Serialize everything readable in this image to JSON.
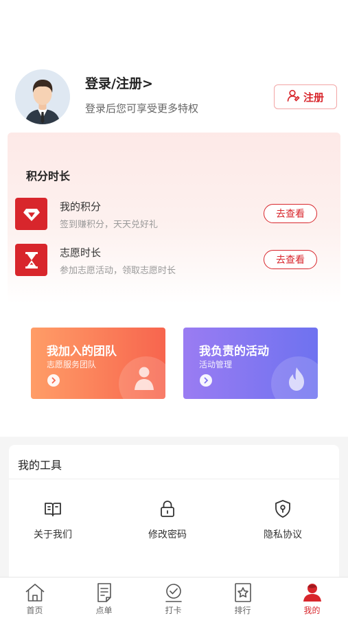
{
  "profile": {
    "login_title": "登录/注册>",
    "login_subtitle": "登录后您可享受更多特权",
    "register_label": "注册"
  },
  "points": {
    "section_title": "积分时长",
    "rows": [
      {
        "icon": "diamond-icon",
        "title": "我的积分",
        "subtitle": "签到赚积分，天天兑好礼",
        "action": "去查看"
      },
      {
        "icon": "hourglass-icon",
        "title": "志愿时长",
        "subtitle": "参加志愿活动，领取志愿时长",
        "action": "去查看"
      }
    ]
  },
  "cards": [
    {
      "title": "我加入的团队",
      "subtitle": "志愿服务团队",
      "icon": "person-icon"
    },
    {
      "title": "我负责的活动",
      "subtitle": "活动管理",
      "icon": "flame-icon"
    }
  ],
  "tools": {
    "title": "我的工具",
    "items": [
      {
        "label": "关于我们",
        "icon": "book-icon"
      },
      {
        "label": "修改密码",
        "icon": "lock-icon"
      },
      {
        "label": "隐私协议",
        "icon": "shield-lock-icon"
      }
    ]
  },
  "tabbar": {
    "tabs": [
      {
        "label": "首页",
        "icon": "home-icon"
      },
      {
        "label": "点单",
        "icon": "order-icon"
      },
      {
        "label": "打卡",
        "icon": "check-in-icon"
      },
      {
        "label": "排行",
        "icon": "ranking-icon"
      },
      {
        "label": "我的",
        "icon": "profile-icon"
      }
    ],
    "active_index": 4
  },
  "colors": {
    "primary": "#d8262c",
    "team_card": "#f7654e",
    "activity_card": "#6e72f0"
  }
}
